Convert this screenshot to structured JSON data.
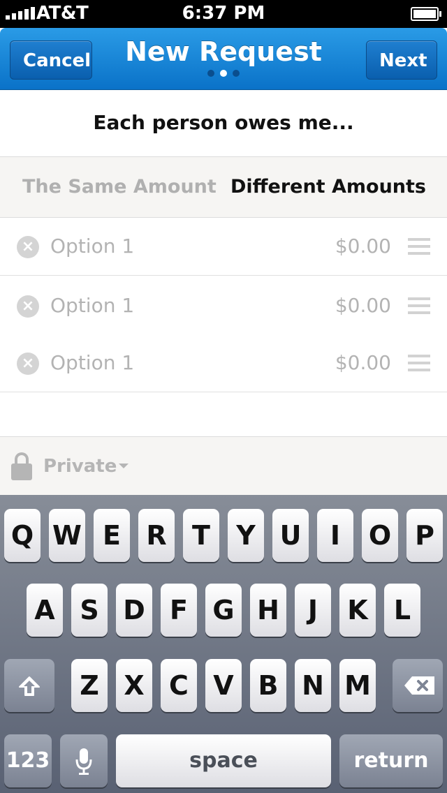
{
  "status_bar": {
    "carrier": "AT&T",
    "time": "6:37 PM"
  },
  "nav": {
    "cancel_label": "Cancel",
    "title": "New Request",
    "next_label": "Next",
    "page_indicator": {
      "total": 3,
      "current": 2
    }
  },
  "heading": "Each person owes me...",
  "amount_mode": {
    "options": [
      "The Same Amount",
      "Different Amounts"
    ],
    "selected": "Different Amounts"
  },
  "options_list": [
    {
      "label": "Option 1",
      "amount": "$0.00"
    },
    {
      "label": "Option 1",
      "amount": "$0.00"
    },
    {
      "label": "Option 1",
      "amount": "$0.00"
    }
  ],
  "privacy": {
    "label": "Private"
  },
  "keyboard": {
    "row1": [
      "Q",
      "W",
      "E",
      "R",
      "T",
      "Y",
      "U",
      "I",
      "O",
      "P"
    ],
    "row2": [
      "A",
      "S",
      "D",
      "F",
      "G",
      "H",
      "J",
      "K",
      "L"
    ],
    "row3": [
      "Z",
      "X",
      "C",
      "V",
      "B",
      "N",
      "M"
    ],
    "numbers_label": "123",
    "space_label": "space",
    "return_label": "return"
  },
  "colors": {
    "nav_blue": "#0a72c8",
    "selected_text": "#111111",
    "muted_text": "#b0b0b0"
  }
}
